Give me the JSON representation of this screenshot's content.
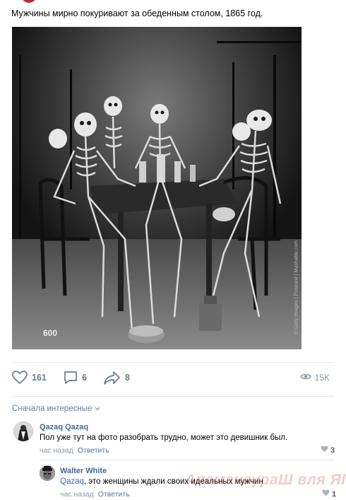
{
  "post": {
    "text": "Мужчины мирно покуривают за обеденным столом, 1865 год.",
    "photo_number": "600",
    "photo_credit": "© Getty Images | Pinterest | Mashable.com"
  },
  "actions": {
    "likes": "161",
    "comments": "6",
    "shares": "8",
    "views": "15K"
  },
  "comments_section": {
    "sort_label": "Сначала интересные",
    "items": [
      {
        "author": "Qazaq Qazaq",
        "text": "Пол уже тут на фото разобрать трудно, может это девишник был.",
        "time": "час назад",
        "reply_label": "Ответить",
        "likes": "3"
      },
      {
        "author": "Walter White",
        "mention": "Qazaq",
        "text": ", это женщины ждали своих идеальных мужчин",
        "time": "час назад",
        "reply_label": "Ответить",
        "likes": "1"
      }
    ]
  },
  "watermark": "АпаманаураШ вля ЯП",
  "colors": {
    "link": "#3d6a9b",
    "muted": "#8a96a3",
    "action": "#6b7a8c",
    "divider": "#e7e8ec"
  },
  "icons": [
    "heart-icon",
    "comment-icon",
    "share-icon",
    "eye-icon",
    "chevron-down-icon"
  ]
}
